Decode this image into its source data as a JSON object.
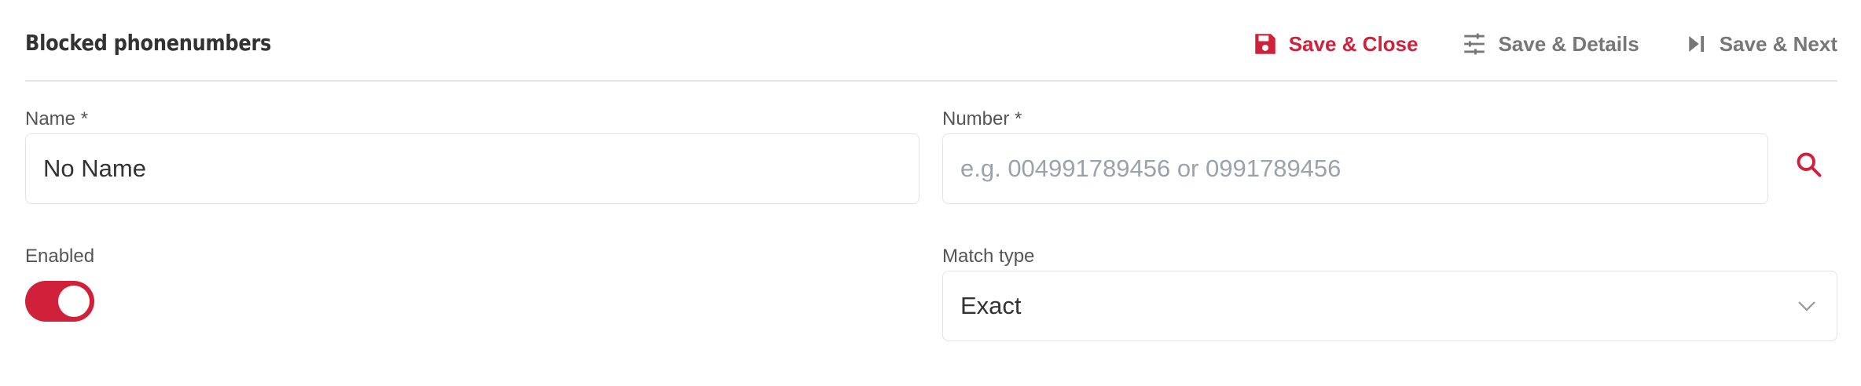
{
  "header": {
    "title": "Blocked phonenumbers",
    "actions": [
      {
        "label": "Save & Close",
        "icon": "floppy-disk-icon",
        "style": "primary"
      },
      {
        "label": "Save & Details",
        "icon": "sliders-icon",
        "style": "secondary"
      },
      {
        "label": "Save & Next",
        "icon": "skip-next-icon",
        "style": "secondary"
      }
    ]
  },
  "form": {
    "name": {
      "label": "Name *",
      "value": "No Name"
    },
    "number": {
      "label": "Number *",
      "value": "",
      "placeholder": "e.g. 004991789456 or 0991789456",
      "search_icon": "search-icon"
    },
    "enabled": {
      "label": "Enabled",
      "value": true
    },
    "match_type": {
      "label": "Match type",
      "value": "Exact"
    }
  },
  "colors": {
    "accent": "#d0203a",
    "muted": "#777777",
    "border": "#e3e3e3",
    "placeholder": "#9aa3ab"
  }
}
